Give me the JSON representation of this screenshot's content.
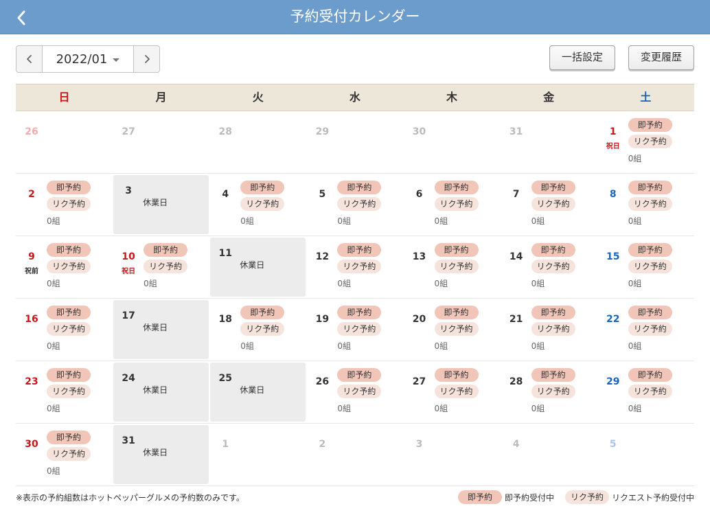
{
  "header": {
    "title": "予約受付カレンダー"
  },
  "nav": {
    "month": "2022/01"
  },
  "buttons": {
    "bulk": "一括設定",
    "history": "変更履歴"
  },
  "weekdays": [
    "日",
    "月",
    "火",
    "水",
    "木",
    "金",
    "土"
  ],
  "labels": {
    "instant": "即予約",
    "request": "リク予約",
    "closed": "休業日"
  },
  "weeks": [
    [
      {
        "date": "26",
        "type": "other-sun"
      },
      {
        "date": "27",
        "type": "other"
      },
      {
        "date": "28",
        "type": "other"
      },
      {
        "date": "29",
        "type": "other"
      },
      {
        "date": "30",
        "type": "other"
      },
      {
        "date": "31",
        "type": "other"
      },
      {
        "date": "1",
        "type": "open",
        "color": "hol",
        "holiday": "祝日",
        "holidayColor": "red",
        "count": "0組"
      }
    ],
    [
      {
        "date": "2",
        "type": "open",
        "color": "sun",
        "count": "0組"
      },
      {
        "date": "3",
        "type": "closed"
      },
      {
        "date": "4",
        "type": "open",
        "color": "",
        "count": "0組"
      },
      {
        "date": "5",
        "type": "open",
        "color": "",
        "count": "0組"
      },
      {
        "date": "6",
        "type": "open",
        "color": "",
        "count": "0組"
      },
      {
        "date": "7",
        "type": "open",
        "color": "",
        "count": "0組"
      },
      {
        "date": "8",
        "type": "open",
        "color": "sat",
        "count": "0組"
      }
    ],
    [
      {
        "date": "9",
        "type": "open",
        "color": "sun",
        "holiday": "祝前",
        "holidayColor": "",
        "count": "0組"
      },
      {
        "date": "10",
        "type": "open",
        "color": "hol",
        "holiday": "祝日",
        "holidayColor": "red",
        "count": "0組"
      },
      {
        "date": "11",
        "type": "closed"
      },
      {
        "date": "12",
        "type": "open",
        "color": "",
        "count": "0組"
      },
      {
        "date": "13",
        "type": "open",
        "color": "",
        "count": "0組"
      },
      {
        "date": "14",
        "type": "open",
        "color": "",
        "count": "0組"
      },
      {
        "date": "15",
        "type": "open",
        "color": "sat",
        "count": "0組"
      }
    ],
    [
      {
        "date": "16",
        "type": "open",
        "color": "sun",
        "count": "0組"
      },
      {
        "date": "17",
        "type": "closed"
      },
      {
        "date": "18",
        "type": "open",
        "color": "",
        "count": "0組"
      },
      {
        "date": "19",
        "type": "open",
        "color": "",
        "count": "0組"
      },
      {
        "date": "20",
        "type": "open",
        "color": "",
        "count": "0組"
      },
      {
        "date": "21",
        "type": "open",
        "color": "",
        "count": "0組"
      },
      {
        "date": "22",
        "type": "open",
        "color": "sat",
        "count": "0組"
      }
    ],
    [
      {
        "date": "23",
        "type": "open",
        "color": "sun",
        "count": "0組"
      },
      {
        "date": "24",
        "type": "closed"
      },
      {
        "date": "25",
        "type": "closed"
      },
      {
        "date": "26",
        "type": "open",
        "color": "",
        "count": "0組"
      },
      {
        "date": "27",
        "type": "open",
        "color": "",
        "count": "0組"
      },
      {
        "date": "28",
        "type": "open",
        "color": "",
        "count": "0組"
      },
      {
        "date": "29",
        "type": "open",
        "color": "sat",
        "count": "0組"
      }
    ],
    [
      {
        "date": "30",
        "type": "open",
        "color": "sun",
        "count": "0組"
      },
      {
        "date": "31",
        "type": "closed"
      },
      {
        "date": "1",
        "type": "other"
      },
      {
        "date": "2",
        "type": "other"
      },
      {
        "date": "3",
        "type": "other"
      },
      {
        "date": "4",
        "type": "other"
      },
      {
        "date": "5",
        "type": "other-sat"
      }
    ]
  ],
  "footer": {
    "note": "※表示の予約組数はホットペッパーグルメの予約数のみです。",
    "legend_instant_label": "即予約",
    "legend_instant_text": "即予約受付中",
    "legend_request_label": "リク予約",
    "legend_request_text": "リクエスト予約受付中"
  },
  "colors": {
    "header": "#6b9ccb",
    "sunday": "#c8161d",
    "saturday": "#1565c0",
    "instant_pill": "#f1c5b7",
    "request_pill": "#f6e3dc",
    "closed_bg": "#ececec",
    "weekday_header_bg": "#ede7d9"
  },
  "icons": {
    "back": "chevron-left-icon",
    "prev": "chevron-left-icon",
    "next": "chevron-right-icon",
    "dropdown": "caret-down-icon"
  }
}
